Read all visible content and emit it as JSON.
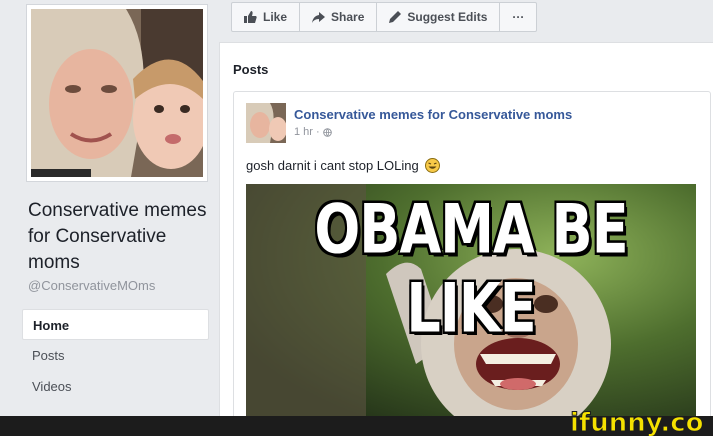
{
  "page": {
    "name": "Conservative memes for Conservative moms",
    "handle": "@ConservativeMOms"
  },
  "actions": {
    "like": "Like",
    "share": "Share",
    "suggest_edits": "Suggest Edits",
    "more": "···"
  },
  "nav": {
    "items": [
      {
        "label": "Home",
        "active": true
      },
      {
        "label": "Posts",
        "active": false
      },
      {
        "label": "Videos",
        "active": false
      }
    ]
  },
  "posts": {
    "title": "Posts",
    "post": {
      "author": "Conservative memes for Conservative moms",
      "time": "1 hr",
      "separator": "·",
      "text": "gosh darnit i cant stop LOLing",
      "meme_caption": "OBAMA BE LIKE"
    }
  },
  "watermark": {
    "text": "ifunny.co"
  },
  "colors": {
    "background": "#e9ebee",
    "link": "#365899",
    "watermark": "#f5e100",
    "bar": "#1c1c1c"
  }
}
